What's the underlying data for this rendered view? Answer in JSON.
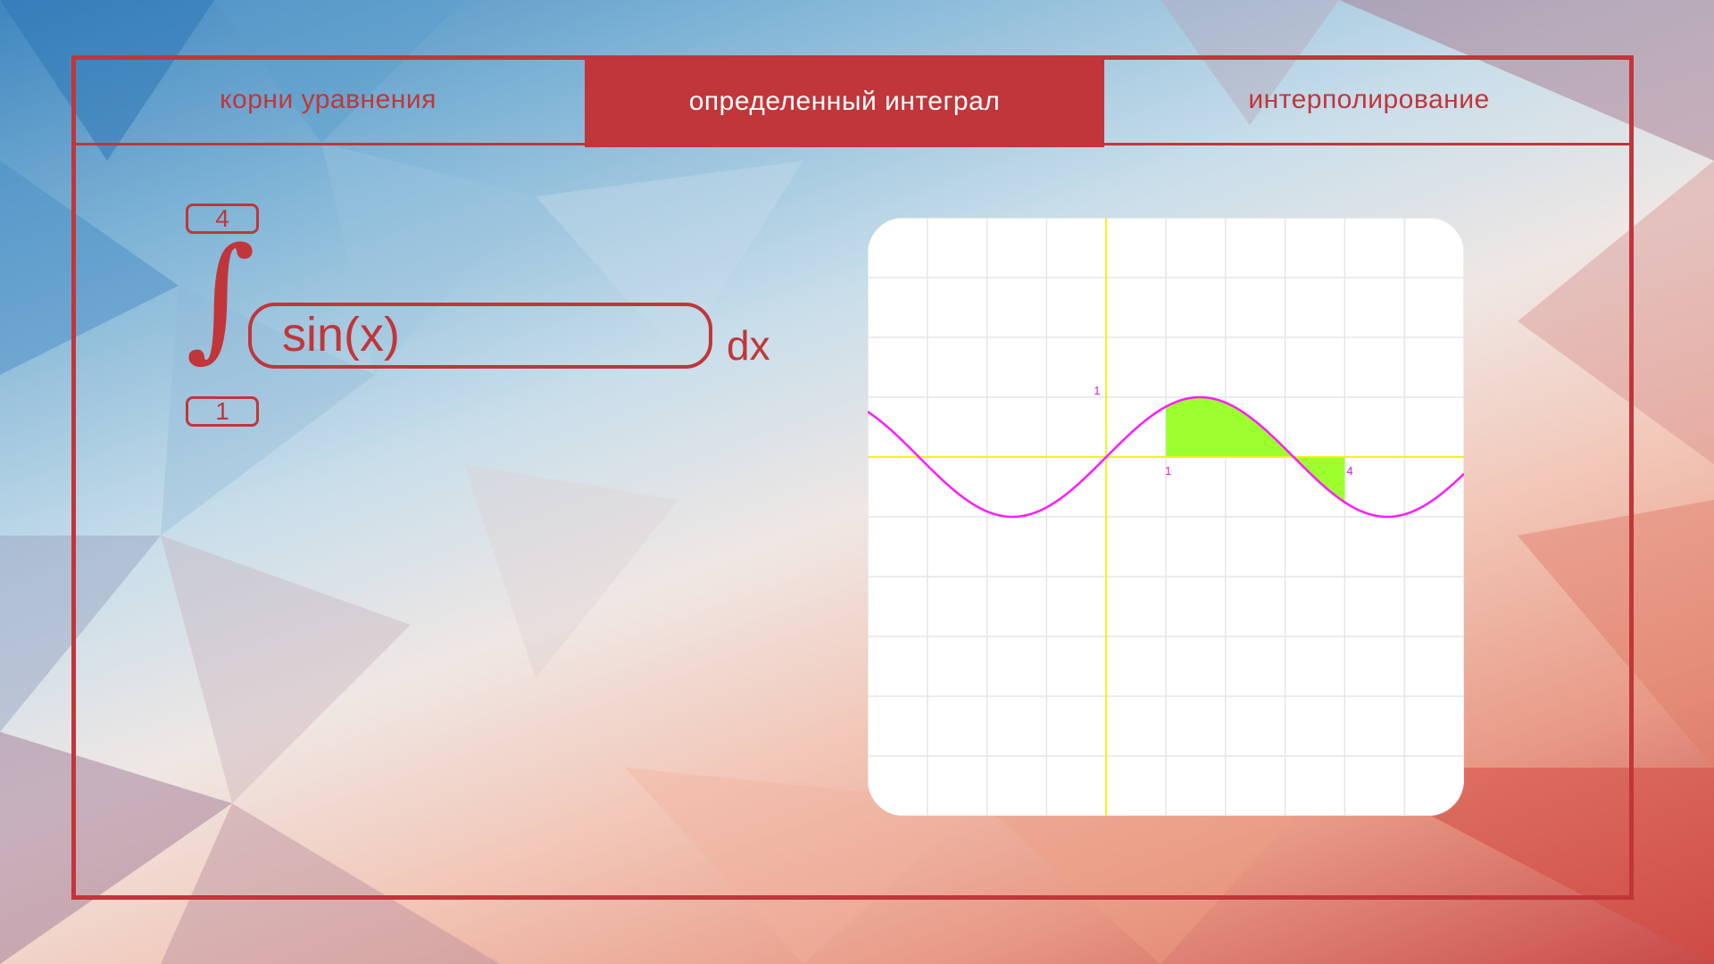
{
  "tabs": [
    {
      "label": "корни уравнения",
      "active": false
    },
    {
      "label": "определенный интеграл",
      "active": true
    },
    {
      "label": "интерполирование",
      "active": false
    }
  ],
  "integral": {
    "upper_limit": "4",
    "lower_limit": "1",
    "function": "sin(x)",
    "differential": "dx",
    "symbol": "∫"
  },
  "graph": {
    "function": "sin(x)",
    "x_range": [
      -4,
      6
    ],
    "y_range": [
      -6,
      4
    ],
    "grid_step": 1,
    "integrate_from": 1,
    "integrate_to": 4,
    "labels": {
      "y_tick": "1",
      "x_start": "1",
      "x_end": "4"
    },
    "colors": {
      "curve": "#ff1aff",
      "axes": "#f2f21a",
      "fill": "#9cff2e",
      "grid": "#e6e6e6",
      "label": "#d81bd8"
    }
  },
  "colors": {
    "accent": "#c0363a",
    "active_tab_text": "#ffffff"
  }
}
